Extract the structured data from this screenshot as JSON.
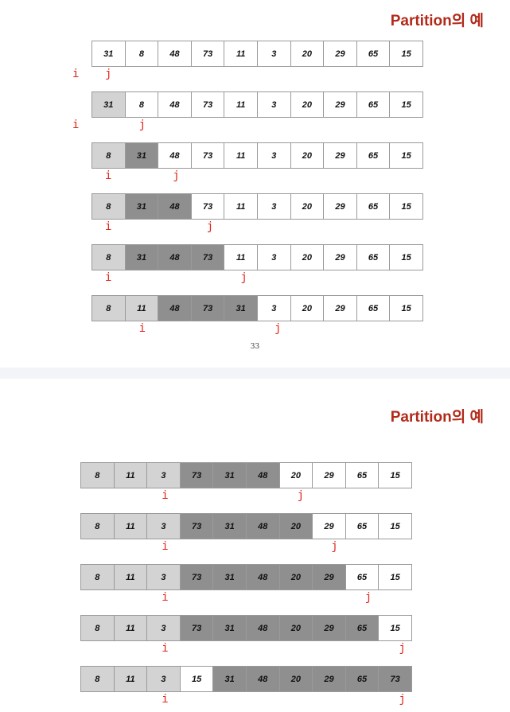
{
  "slides": [
    {
      "title": "Partition의 예",
      "page_number": "33",
      "rows": [
        {
          "cells": [
            {
              "v": "31",
              "s": "white"
            },
            {
              "v": "8",
              "s": "white"
            },
            {
              "v": "48",
              "s": "white"
            },
            {
              "v": "73",
              "s": "white"
            },
            {
              "v": "11",
              "s": "white"
            },
            {
              "v": "3",
              "s": "white"
            },
            {
              "v": "20",
              "s": "white"
            },
            {
              "v": "29",
              "s": "white"
            },
            {
              "v": "65",
              "s": "white"
            },
            {
              "v": "15",
              "s": "white"
            }
          ],
          "i": -1,
          "j": 0
        },
        {
          "cells": [
            {
              "v": "31",
              "s": "light"
            },
            {
              "v": "8",
              "s": "white"
            },
            {
              "v": "48",
              "s": "white"
            },
            {
              "v": "73",
              "s": "white"
            },
            {
              "v": "11",
              "s": "white"
            },
            {
              "v": "3",
              "s": "white"
            },
            {
              "v": "20",
              "s": "white"
            },
            {
              "v": "29",
              "s": "white"
            },
            {
              "v": "65",
              "s": "white"
            },
            {
              "v": "15",
              "s": "white"
            }
          ],
          "i": -1,
          "j": 1
        },
        {
          "cells": [
            {
              "v": "8",
              "s": "light"
            },
            {
              "v": "31",
              "s": "dark"
            },
            {
              "v": "48",
              "s": "white"
            },
            {
              "v": "73",
              "s": "white"
            },
            {
              "v": "11",
              "s": "white"
            },
            {
              "v": "3",
              "s": "white"
            },
            {
              "v": "20",
              "s": "white"
            },
            {
              "v": "29",
              "s": "white"
            },
            {
              "v": "65",
              "s": "white"
            },
            {
              "v": "15",
              "s": "white"
            }
          ],
          "i": 0,
          "j": 2
        },
        {
          "cells": [
            {
              "v": "8",
              "s": "light"
            },
            {
              "v": "31",
              "s": "dark"
            },
            {
              "v": "48",
              "s": "dark"
            },
            {
              "v": "73",
              "s": "white"
            },
            {
              "v": "11",
              "s": "white"
            },
            {
              "v": "3",
              "s": "white"
            },
            {
              "v": "20",
              "s": "white"
            },
            {
              "v": "29",
              "s": "white"
            },
            {
              "v": "65",
              "s": "white"
            },
            {
              "v": "15",
              "s": "white"
            }
          ],
          "i": 0,
          "j": 3
        },
        {
          "cells": [
            {
              "v": "8",
              "s": "light"
            },
            {
              "v": "31",
              "s": "dark"
            },
            {
              "v": "48",
              "s": "dark"
            },
            {
              "v": "73",
              "s": "dark"
            },
            {
              "v": "11",
              "s": "white"
            },
            {
              "v": "3",
              "s": "white"
            },
            {
              "v": "20",
              "s": "white"
            },
            {
              "v": "29",
              "s": "white"
            },
            {
              "v": "65",
              "s": "white"
            },
            {
              "v": "15",
              "s": "white"
            }
          ],
          "i": 0,
          "j": 4
        },
        {
          "cells": [
            {
              "v": "8",
              "s": "light"
            },
            {
              "v": "11",
              "s": "light"
            },
            {
              "v": "48",
              "s": "dark"
            },
            {
              "v": "73",
              "s": "dark"
            },
            {
              "v": "31",
              "s": "dark"
            },
            {
              "v": "3",
              "s": "white"
            },
            {
              "v": "20",
              "s": "white"
            },
            {
              "v": "29",
              "s": "white"
            },
            {
              "v": "65",
              "s": "white"
            },
            {
              "v": "15",
              "s": "white"
            }
          ],
          "i": 1,
          "j": 5
        }
      ]
    },
    {
      "title": "Partition의 예",
      "rows": [
        {
          "cells": [
            {
              "v": "8",
              "s": "light"
            },
            {
              "v": "11",
              "s": "light"
            },
            {
              "v": "3",
              "s": "light"
            },
            {
              "v": "73",
              "s": "dark"
            },
            {
              "v": "31",
              "s": "dark"
            },
            {
              "v": "48",
              "s": "dark"
            },
            {
              "v": "20",
              "s": "white"
            },
            {
              "v": "29",
              "s": "white"
            },
            {
              "v": "65",
              "s": "white"
            },
            {
              "v": "15",
              "s": "white"
            }
          ],
          "i": 2,
          "j": 6
        },
        {
          "cells": [
            {
              "v": "8",
              "s": "light"
            },
            {
              "v": "11",
              "s": "light"
            },
            {
              "v": "3",
              "s": "light"
            },
            {
              "v": "73",
              "s": "dark"
            },
            {
              "v": "31",
              "s": "dark"
            },
            {
              "v": "48",
              "s": "dark"
            },
            {
              "v": "20",
              "s": "dark"
            },
            {
              "v": "29",
              "s": "white"
            },
            {
              "v": "65",
              "s": "white"
            },
            {
              "v": "15",
              "s": "white"
            }
          ],
          "i": 2,
          "j": 7
        },
        {
          "cells": [
            {
              "v": "8",
              "s": "light"
            },
            {
              "v": "11",
              "s": "light"
            },
            {
              "v": "3",
              "s": "light"
            },
            {
              "v": "73",
              "s": "dark"
            },
            {
              "v": "31",
              "s": "dark"
            },
            {
              "v": "48",
              "s": "dark"
            },
            {
              "v": "20",
              "s": "dark"
            },
            {
              "v": "29",
              "s": "dark"
            },
            {
              "v": "65",
              "s": "white"
            },
            {
              "v": "15",
              "s": "white"
            }
          ],
          "i": 2,
          "j": 8
        },
        {
          "cells": [
            {
              "v": "8",
              "s": "light"
            },
            {
              "v": "11",
              "s": "light"
            },
            {
              "v": "3",
              "s": "light"
            },
            {
              "v": "73",
              "s": "dark"
            },
            {
              "v": "31",
              "s": "dark"
            },
            {
              "v": "48",
              "s": "dark"
            },
            {
              "v": "20",
              "s": "dark"
            },
            {
              "v": "29",
              "s": "dark"
            },
            {
              "v": "65",
              "s": "dark"
            },
            {
              "v": "15",
              "s": "white"
            }
          ],
          "i": 2,
          "j": 9
        },
        {
          "cells": [
            {
              "v": "8",
              "s": "light"
            },
            {
              "v": "11",
              "s": "light"
            },
            {
              "v": "3",
              "s": "light"
            },
            {
              "v": "15",
              "s": "white"
            },
            {
              "v": "31",
              "s": "dark"
            },
            {
              "v": "48",
              "s": "dark"
            },
            {
              "v": "20",
              "s": "dark"
            },
            {
              "v": "29",
              "s": "dark"
            },
            {
              "v": "65",
              "s": "dark"
            },
            {
              "v": "73",
              "s": "dark"
            }
          ],
          "i": 2,
          "j": 9
        }
      ]
    }
  ],
  "pointer_labels": {
    "i": "i",
    "j": "j"
  },
  "colors": {
    "title": "#b22a1a",
    "pointer": "#e0261b",
    "light_cell": "#d3d3d3",
    "dark_cell": "#8f8f8f"
  }
}
